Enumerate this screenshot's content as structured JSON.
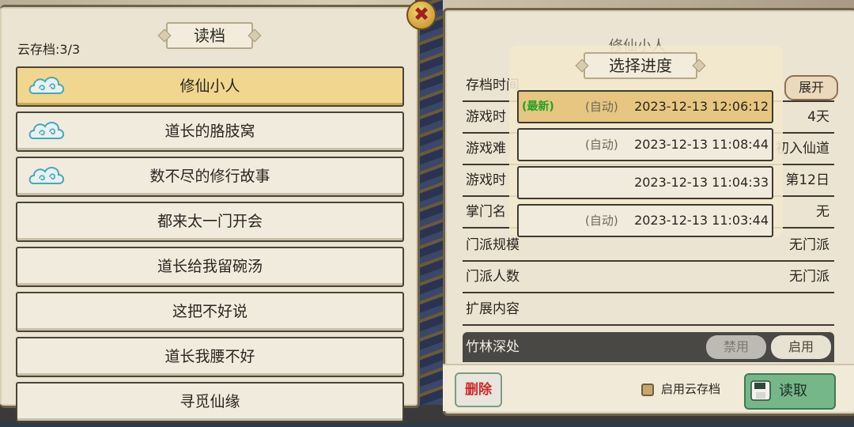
{
  "left_panel": {
    "title": "读档",
    "cloud_count": "云存档:3/3",
    "slots": [
      {
        "name": "修仙小人",
        "cloud": true,
        "selected": true
      },
      {
        "name": "道长的胳肢窝",
        "cloud": true,
        "selected": false
      },
      {
        "name": "数不尽的修行故事",
        "cloud": true,
        "selected": false
      },
      {
        "name": "都来太一门开会",
        "cloud": false,
        "selected": false
      },
      {
        "name": "道长给我留碗汤",
        "cloud": false,
        "selected": false
      },
      {
        "name": "这把不好说",
        "cloud": false,
        "selected": false
      },
      {
        "name": "道长我腰不好",
        "cloud": false,
        "selected": false
      },
      {
        "name": "寻觅仙缘",
        "cloud": false,
        "selected": false
      }
    ]
  },
  "right_panel": {
    "slot_name": "修仙小人",
    "expand_label": "展开",
    "rows": [
      {
        "key": "存档时间",
        "value": ""
      },
      {
        "key": "游戏时",
        "value": "4天"
      },
      {
        "key": "游戏难",
        "value": "初入仙道"
      },
      {
        "key": "游戏时",
        "value": "第12日"
      },
      {
        "key": "掌门名",
        "value": "无"
      },
      {
        "key": "门派规模",
        "value": "无门派"
      },
      {
        "key": "门派人数",
        "value": "无门派"
      },
      {
        "key": "扩展内容",
        "value": ""
      }
    ],
    "mod_row": {
      "name": "竹林深处",
      "disable_label": "禁用",
      "enable_label": "启用"
    }
  },
  "progress_overlay": {
    "title": "选择进度",
    "entries": [
      {
        "newest": "(最新)",
        "auto": "(自动)",
        "time": "2023-12-13 12:06:12",
        "selected": true
      },
      {
        "newest": "",
        "auto": "(自动)",
        "time": "2023-12-13 11:08:44",
        "selected": false
      },
      {
        "newest": "",
        "auto": "",
        "time": "2023-12-13 11:04:33",
        "selected": false
      },
      {
        "newest": "",
        "auto": "(自动)",
        "time": "2023-12-13 11:03:44",
        "selected": false
      }
    ]
  },
  "bottom": {
    "delete_label": "删除",
    "cloud_save_label": "启用云存档",
    "load_label": "读取"
  },
  "close": {
    "icon": "close-icon"
  },
  "colors": {
    "selected_slot": "#f0d68e",
    "newest_text": "#25a125",
    "delete_text": "#cc2a2a",
    "load_button": "#76b78a"
  }
}
